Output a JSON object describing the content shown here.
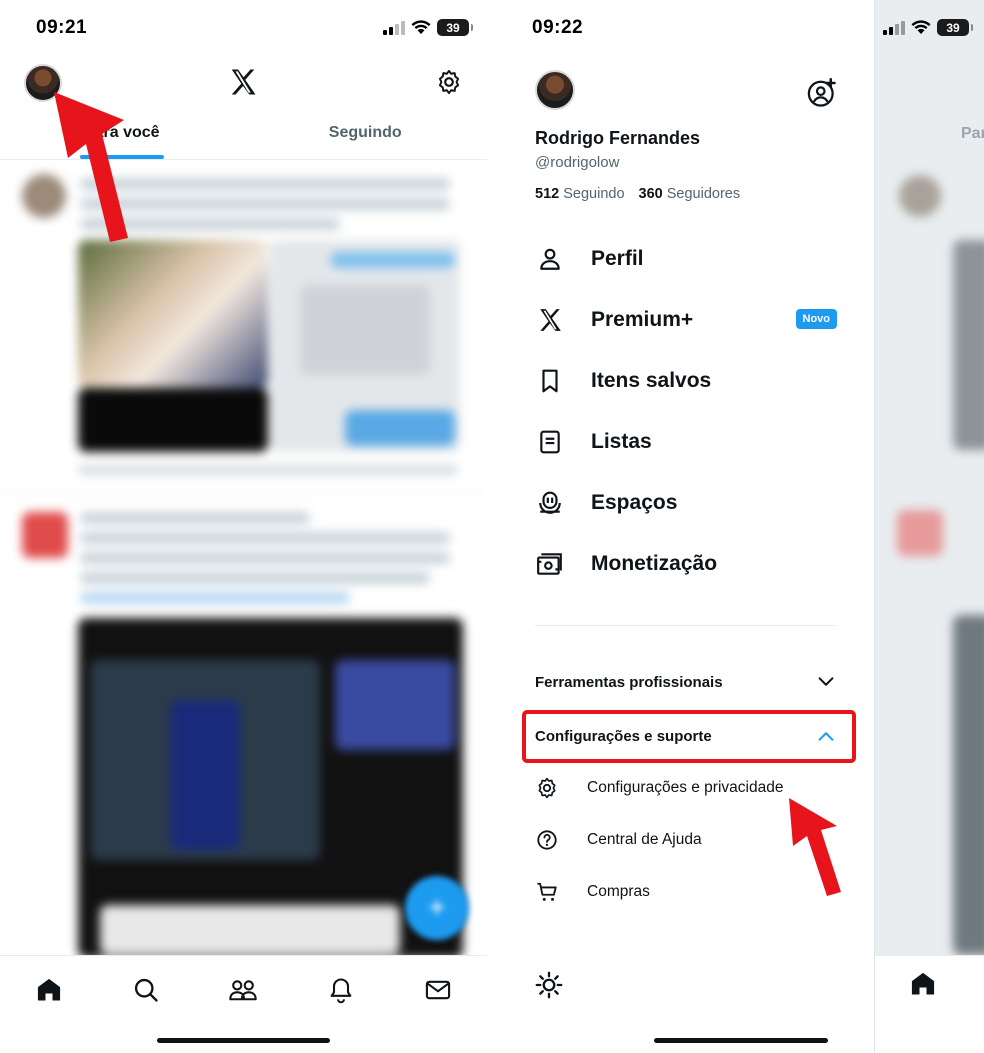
{
  "left_screen": {
    "status": {
      "time": "09:21",
      "battery": "39"
    },
    "header": {
      "logo_icon": "x-logo-icon",
      "settings_icon": "gear-icon",
      "avatar_icon": "avatar"
    },
    "tabs": [
      {
        "label": "Para você",
        "active": true
      },
      {
        "label": "Seguindo",
        "active": false
      }
    ],
    "bottom_nav": [
      "home-icon",
      "search-icon",
      "communities-icon",
      "notifications-icon",
      "messages-icon"
    ]
  },
  "drawer": {
    "status": {
      "time": "09:22"
    },
    "profile": {
      "name": "Rodrigo Fernandes",
      "handle": "@rodrigolow",
      "following_count": "512",
      "following_label": "Seguindo",
      "followers_count": "360",
      "followers_label": "Seguidores"
    },
    "menu": [
      {
        "label": "Perfil",
        "icon": "person-icon"
      },
      {
        "label": "Premium+",
        "icon": "x-logo-icon",
        "badge": "Novo"
      },
      {
        "label": "Itens salvos",
        "icon": "bookmark-icon"
      },
      {
        "label": "Listas",
        "icon": "list-icon"
      },
      {
        "label": "Espaços",
        "icon": "microphone-icon"
      },
      {
        "label": "Monetização",
        "icon": "money-icon"
      }
    ],
    "sections": {
      "pro_tools": "Ferramentas profissionais",
      "settings_support": "Configurações e suporte"
    },
    "sub_items": [
      {
        "label": "Configurações e privacidade",
        "icon": "gear-icon"
      },
      {
        "label": "Central de Ajuda",
        "icon": "help-icon"
      },
      {
        "label": "Compras",
        "icon": "cart-icon"
      }
    ],
    "footer_icon": "sun-icon"
  },
  "right_screen": {
    "battery": "39",
    "tab_partial": "Par"
  },
  "colors": {
    "accent": "#1d9bf0",
    "annotation_red": "#e8141b",
    "text": "#0f1419",
    "muted": "#536471"
  }
}
